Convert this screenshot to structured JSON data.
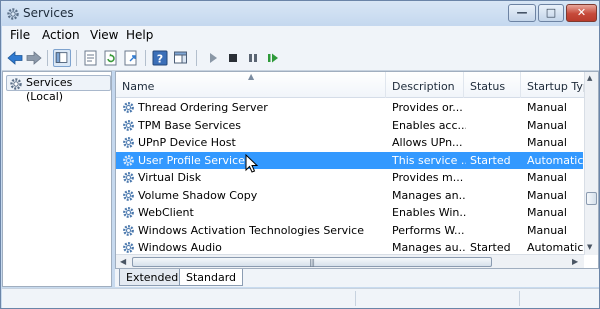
{
  "window": {
    "title": "Services"
  },
  "menu": [
    "File",
    "Action",
    "View",
    "Help"
  ],
  "toolbar": {
    "icons": [
      "back-icon",
      "forward-icon",
      "show-hide-tree-icon",
      "properties-icon",
      "refresh-icon",
      "export-list-icon",
      "help-icon",
      "show-hide-action-pane-icon",
      "start-service-icon",
      "stop-service-icon",
      "pause-service-icon",
      "restart-service-icon"
    ]
  },
  "tree": {
    "root_label": "Services (Local)"
  },
  "columns": {
    "name": "Name",
    "description": "Description",
    "status": "Status",
    "startup": "Startup Typ"
  },
  "services": [
    {
      "name": "Thread Ordering Server",
      "description": "Provides or...",
      "status": "",
      "startup": "Manual"
    },
    {
      "name": "TPM Base Services",
      "description": "Enables acc...",
      "status": "",
      "startup": "Manual"
    },
    {
      "name": "UPnP Device Host",
      "description": "Allows UPn...",
      "status": "",
      "startup": "Manual"
    },
    {
      "name": "User Profile Service",
      "description": "This service ...",
      "status": "Started",
      "startup": "Automatic",
      "selected": true
    },
    {
      "name": "Virtual Disk",
      "description": "Provides m...",
      "status": "",
      "startup": "Manual"
    },
    {
      "name": "Volume Shadow Copy",
      "description": "Manages an...",
      "status": "",
      "startup": "Manual"
    },
    {
      "name": "WebClient",
      "description": "Enables Win...",
      "status": "",
      "startup": "Manual"
    },
    {
      "name": "Windows Activation Technologies Service",
      "description": "Performs W...",
      "status": "",
      "startup": "Manual"
    },
    {
      "name": "Windows Audio",
      "description": "Manages au...",
      "status": "Started",
      "startup": "Automatic"
    }
  ],
  "tabs": {
    "extended": "Extended",
    "standard": "Standard"
  },
  "colors": {
    "selection": "#3399ff",
    "gear": "#3f6fa3"
  }
}
